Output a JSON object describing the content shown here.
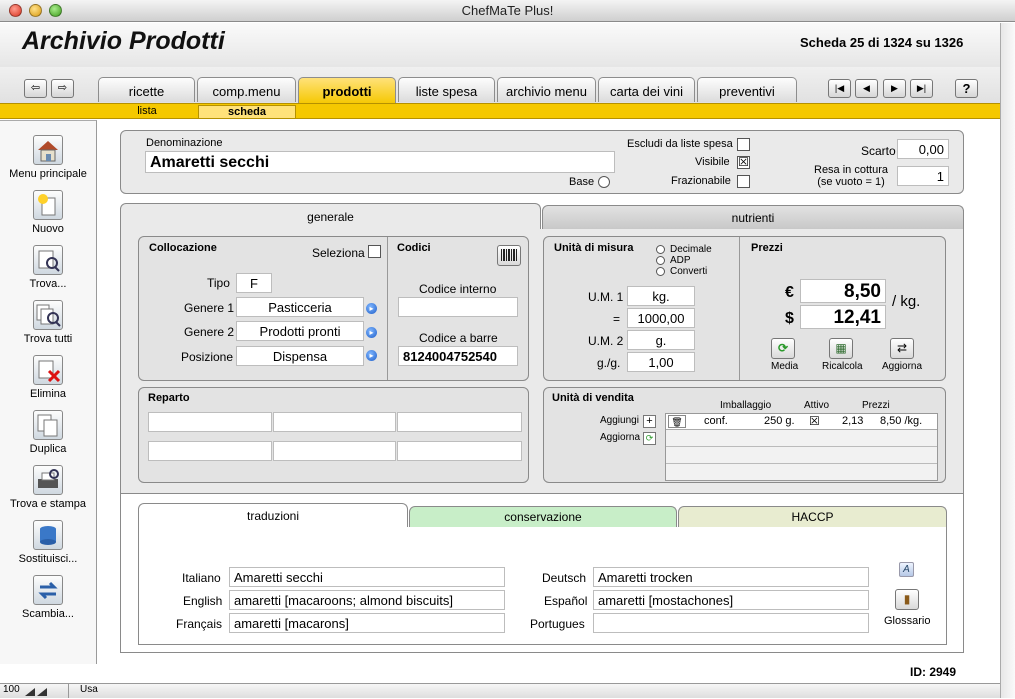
{
  "window": {
    "title": "ChefMaTe Plus!"
  },
  "header": {
    "title": "Archivio Prodotti",
    "record_info": "Scheda 25 di 1324 su 1326"
  },
  "nav": {
    "back": "⇦",
    "forward": "⇨",
    "first": "|◀",
    "prev": "◀",
    "next": "▶",
    "last": "▶|",
    "help": "?"
  },
  "tabs": [
    {
      "label": "ricette"
    },
    {
      "label": "comp.menu"
    },
    {
      "label": "prodotti"
    },
    {
      "label": "liste spesa"
    },
    {
      "label": "archivio menu"
    },
    {
      "label": "carta dei vini"
    },
    {
      "label": "preventivi"
    }
  ],
  "subtabs": {
    "lista": "lista",
    "scheda": "scheda"
  },
  "sidebar": {
    "items": [
      {
        "label": "Menu principale",
        "icon": "house-icon"
      },
      {
        "label": "Nuovo",
        "icon": "new-document-icon"
      },
      {
        "label": "Trova...",
        "icon": "find-icon"
      },
      {
        "label": "Trova tutti",
        "icon": "find-all-icon"
      },
      {
        "label": "Elimina",
        "icon": "delete-icon"
      },
      {
        "label": "Duplica",
        "icon": "duplicate-icon"
      },
      {
        "label": "Trova e stampa",
        "icon": "print-icon"
      },
      {
        "label": "Sostituisci...",
        "icon": "replace-icon"
      },
      {
        "label": "Scambia...",
        "icon": "swap-icon"
      }
    ]
  },
  "product": {
    "denominazione_label": "Denominazione",
    "denominazione": "Amaretti secchi",
    "base_label": "Base",
    "escludi_label": "Escludi da liste spesa",
    "visibile_label": "Visibile",
    "visibile_mark": "☒",
    "frazionabile_label": "Frazionabile",
    "scarto_label": "Scarto",
    "scarto": "0,00",
    "resa_label": "Resa in cottura",
    "resa_sub": "(se vuoto = 1)",
    "resa": "1"
  },
  "main_tabs": {
    "generale": "generale",
    "nutrienti": "nutrienti"
  },
  "collocazione": {
    "title": "Collocazione",
    "seleziona_label": "Seleziona",
    "tipo_label": "Tipo",
    "tipo": "F",
    "genere1_label": "Genere 1",
    "genere1": "Pasticceria",
    "genere2_label": "Genere 2",
    "genere2": "Prodotti pronti",
    "posizione_label": "Posizione",
    "posizione": "Dispensa"
  },
  "codici": {
    "title": "Codici",
    "interno_label": "Codice interno",
    "interno": "",
    "barre_label": "Codice a barre",
    "barre": "8124004752540"
  },
  "unita": {
    "title": "Unità di misura",
    "options": [
      "Decimale",
      "ADP",
      "Converti"
    ],
    "um1_label": "U.M. 1",
    "um1": "kg.",
    "eq_label": "=",
    "eq": "1000,00",
    "um2_label": "U.M. 2",
    "um2": "g.",
    "gg_label": "g./g.",
    "gg": "1,00"
  },
  "prezzi": {
    "title": "Prezzi",
    "eur_sym": "€",
    "eur": "8,50",
    "usd_sym": "$",
    "usd": "12,41",
    "unit": "/ kg.",
    "media_label": "Media",
    "ricalcola_label": "Ricalcola",
    "aggiorna_label": "Aggiorna"
  },
  "reparto": {
    "title": "Reparto"
  },
  "vendita": {
    "title": "Unità di vendita",
    "aggiungi_label": "Aggiungi",
    "aggiorna_label": "Aggiorna",
    "col_imballaggio": "Imballaggio",
    "col_attivo": "Attivo",
    "col_prezzi": "Prezzi",
    "rows": [
      {
        "tipo": "conf.",
        "qty": "250 g.",
        "attivo": "☒",
        "prezzo": "2,13",
        "prezzo_unit": "8,50 /kg."
      }
    ]
  },
  "bottom_tabs": {
    "traduzioni": "traduzioni",
    "conservazione": "conservazione",
    "haccp": "HACCP"
  },
  "traduzioni": {
    "italiano_label": "Italiano",
    "italiano": "Amaretti secchi",
    "english_label": "English",
    "english": "amaretti [macaroons; almond biscuits]",
    "francais_label": "Français",
    "francais": "amaretti [macarons]",
    "deutsch_label": "Deutsch",
    "deutsch": "Amaretti trocken",
    "espanol_label": "Español",
    "espanol": "amaretti [mostachones]",
    "portugues_label": "Portugues",
    "portugues": "",
    "glossario_label": "Glossario"
  },
  "footer": {
    "id": "ID: 2949",
    "zoom": "100",
    "mode": "Usa"
  },
  "colors": {
    "accent": "#f5c800",
    "conservazione": "#c8eec8",
    "haccp": "#e8ecd0"
  }
}
